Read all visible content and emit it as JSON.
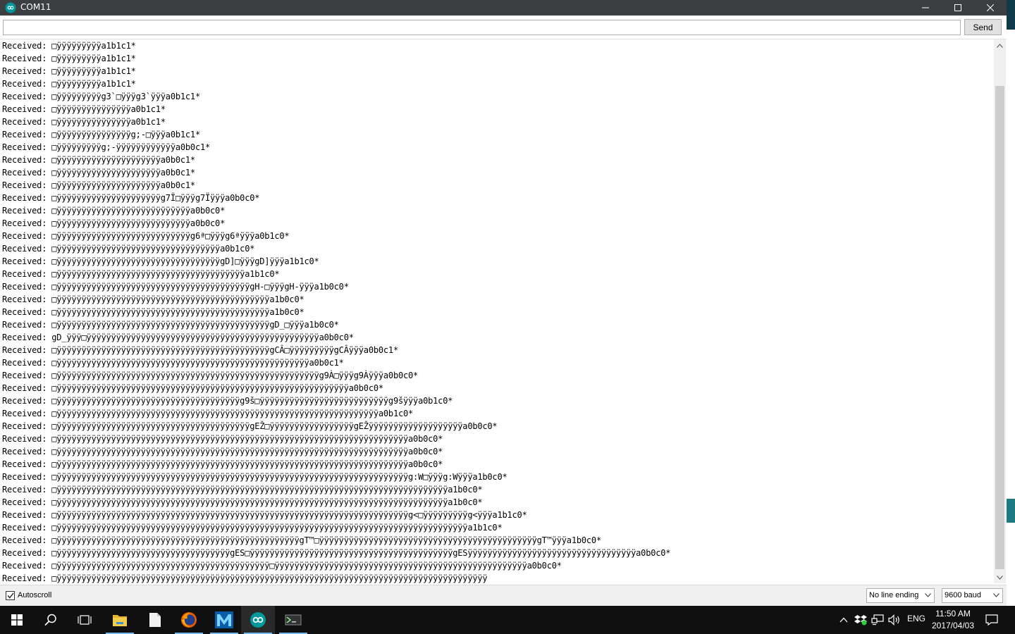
{
  "window": {
    "title": "COM11",
    "accent_color": "#00979c",
    "titlebar_color": "#3c3f41"
  },
  "toolbar": {
    "input_value": "",
    "send_label": "Send"
  },
  "output_lines": [
    "Received: □ÿÿÿÿÿÿÿÿÿa1b1c1*",
    "Received: □ÿÿÿÿÿÿÿÿÿa1b1c1*",
    "Received: □ÿÿÿÿÿÿÿÿÿa1b1c1*",
    "Received: □ÿÿÿÿÿÿÿÿÿa1b1c1*",
    "Received: □ÿÿÿÿÿÿÿÿÿg3`□ÿÿÿg3`ÿÿÿa0b1c1*",
    "Received: □ÿÿÿÿÿÿÿÿÿÿÿÿÿÿÿa0b1c1*",
    "Received: □ÿÿÿÿÿÿÿÿÿÿÿÿÿÿÿa0b1c1*",
    "Received: □ÿÿÿÿÿÿÿÿÿÿÿÿÿÿÿg;-□ÿÿÿa0b1c1*",
    "Received: □ÿÿÿÿÿÿÿÿÿg;-ÿÿÿÿÿÿÿÿÿÿÿÿa0b0c1*",
    "Received: □ÿÿÿÿÿÿÿÿÿÿÿÿÿÿÿÿÿÿÿÿÿa0b0c1*",
    "Received: □ÿÿÿÿÿÿÿÿÿÿÿÿÿÿÿÿÿÿÿÿÿa0b0c1*",
    "Received: □ÿÿÿÿÿÿÿÿÿÿÿÿÿÿÿÿÿÿÿÿÿa0b0c1*",
    "Received: □ÿÿÿÿÿÿÿÿÿÿÿÿÿÿÿÿÿÿÿÿÿg7Ï□ÿÿÿg7Ïÿÿÿa0b0c0*",
    "Received: □ÿÿÿÿÿÿÿÿÿÿÿÿÿÿÿÿÿÿÿÿÿÿÿÿÿÿÿa0b0c0*",
    "Received: □ÿÿÿÿÿÿÿÿÿÿÿÿÿÿÿÿÿÿÿÿÿÿÿÿÿÿÿa0b0c0*",
    "Received: □ÿÿÿÿÿÿÿÿÿÿÿÿÿÿÿÿÿÿÿÿÿÿÿÿÿÿÿg6ª□ÿÿÿg6ªÿÿÿa0b1c0*",
    "Received: □ÿÿÿÿÿÿÿÿÿÿÿÿÿÿÿÿÿÿÿÿÿÿÿÿÿÿÿÿÿÿÿÿÿa0b1c0*",
    "Received: □ÿÿÿÿÿÿÿÿÿÿÿÿÿÿÿÿÿÿÿÿÿÿÿÿÿÿÿÿÿÿÿÿÿgD]□ÿÿÿgD]ÿÿÿa1b1c0*",
    "Received: □ÿÿÿÿÿÿÿÿÿÿÿÿÿÿÿÿÿÿÿÿÿÿÿÿÿÿÿÿÿÿÿÿÿÿÿÿÿÿa1b1c0*",
    "Received: □ÿÿÿÿÿÿÿÿÿÿÿÿÿÿÿÿÿÿÿÿÿÿÿÿÿÿÿÿÿÿÿÿÿÿÿÿÿÿÿgH-□ÿÿÿgH-ÿÿÿa1b0c0*",
    "Received: □ÿÿÿÿÿÿÿÿÿÿÿÿÿÿÿÿÿÿÿÿÿÿÿÿÿÿÿÿÿÿÿÿÿÿÿÿÿÿÿÿÿÿÿa1b0c0*",
    "Received: □ÿÿÿÿÿÿÿÿÿÿÿÿÿÿÿÿÿÿÿÿÿÿÿÿÿÿÿÿÿÿÿÿÿÿÿÿÿÿÿÿÿÿÿa1b0c0*",
    "Received: □ÿÿÿÿÿÿÿÿÿÿÿÿÿÿÿÿÿÿÿÿÿÿÿÿÿÿÿÿÿÿÿÿÿÿÿÿÿÿÿÿÿÿÿgD_□ÿÿÿa1b0c0*",
    "Received: gD_ÿÿÿ□ÿÿÿÿÿÿÿÿÿÿÿÿÿÿÿÿÿÿÿÿÿÿÿÿÿÿÿÿÿÿÿÿÿÿÿÿÿÿÿÿÿÿÿÿÿÿÿa0b0c0*",
    "Received: □ÿÿÿÿÿÿÿÿÿÿÿÿÿÿÿÿÿÿÿÿÿÿÿÿÿÿÿÿÿÿÿÿÿÿÿÿÿÿÿÿÿÿÿgCÂ□ÿÿÿÿÿÿÿÿÿgCÂÿÿÿa0b0c1*",
    "Received: □ÿÿÿÿÿÿÿÿÿÿÿÿÿÿÿÿÿÿÿÿÿÿÿÿÿÿÿÿÿÿÿÿÿÿÿÿÿÿÿÿÿÿÿÿÿÿÿÿÿÿÿa0b0c1*",
    "Received: □ÿÿÿÿÿÿÿÿÿÿÿÿÿÿÿÿÿÿÿÿÿÿÿÿÿÿÿÿÿÿÿÿÿÿÿÿÿÿÿÿÿÿÿÿÿÿÿÿÿÿÿÿÿg9À□ÿÿÿg9Àÿÿÿa0b0c0*",
    "Received: □ÿÿÿÿÿÿÿÿÿÿÿÿÿÿÿÿÿÿÿÿÿÿÿÿÿÿÿÿÿÿÿÿÿÿÿÿÿÿÿÿÿÿÿÿÿÿÿÿÿÿÿÿÿÿÿÿÿÿÿa0b0c0*",
    "Received: □ÿÿÿÿÿÿÿÿÿÿÿÿÿÿÿÿÿÿÿÿÿÿÿÿÿÿÿÿÿÿÿÿÿÿÿÿÿg9š□ÿÿÿÿÿÿÿÿÿÿÿÿÿÿÿÿÿÿÿÿÿÿÿÿÿÿg9šÿÿÿa0b1c0*",
    "Received: □ÿÿÿÿÿÿÿÿÿÿÿÿÿÿÿÿÿÿÿÿÿÿÿÿÿÿÿÿÿÿÿÿÿÿÿÿÿÿÿÿÿÿÿÿÿÿÿÿÿÿÿÿÿÿÿÿÿÿÿÿÿÿÿÿÿa0b1c0*",
    "Received: □ÿÿÿÿÿÿÿÿÿÿÿÿÿÿÿÿÿÿÿÿÿÿÿÿÿÿÿÿÿÿÿÿÿÿÿÿÿÿÿgEŽ□ÿÿÿÿÿÿÿÿÿÿÿÿÿÿÿÿÿgEŽÿÿÿÿÿÿÿÿÿÿÿÿÿÿÿÿÿÿÿa0b0c0*",
    "Received: □ÿÿÿÿÿÿÿÿÿÿÿÿÿÿÿÿÿÿÿÿÿÿÿÿÿÿÿÿÿÿÿÿÿÿÿÿÿÿÿÿÿÿÿÿÿÿÿÿÿÿÿÿÿÿÿÿÿÿÿÿÿÿÿÿÿÿÿÿÿÿÿa0b0c0*",
    "Received: □ÿÿÿÿÿÿÿÿÿÿÿÿÿÿÿÿÿÿÿÿÿÿÿÿÿÿÿÿÿÿÿÿÿÿÿÿÿÿÿÿÿÿÿÿÿÿÿÿÿÿÿÿÿÿÿÿÿÿÿÿÿÿÿÿÿÿÿÿÿÿÿa0b0c0*",
    "Received: □ÿÿÿÿÿÿÿÿÿÿÿÿÿÿÿÿÿÿÿÿÿÿÿÿÿÿÿÿÿÿÿÿÿÿÿÿÿÿÿÿÿÿÿÿÿÿÿÿÿÿÿÿÿÿÿÿÿÿÿÿÿÿÿÿÿÿÿÿÿÿÿa0b0c0*",
    "Received: □ÿÿÿÿÿÿÿÿÿÿÿÿÿÿÿÿÿÿÿÿÿÿÿÿÿÿÿÿÿÿÿÿÿÿÿÿÿÿÿÿÿÿÿÿÿÿÿÿÿÿÿÿÿÿÿÿÿÿÿÿÿÿÿÿÿÿÿÿÿÿÿg:W□ÿÿÿg:Wÿÿÿa1b0c0*",
    "Received: □ÿÿÿÿÿÿÿÿÿÿÿÿÿÿÿÿÿÿÿÿÿÿÿÿÿÿÿÿÿÿÿÿÿÿÿÿÿÿÿÿÿÿÿÿÿÿÿÿÿÿÿÿÿÿÿÿÿÿÿÿÿÿÿÿÿÿÿÿÿÿÿÿÿÿÿÿÿÿÿa1b0c0*",
    "Received: □ÿÿÿÿÿÿÿÿÿÿÿÿÿÿÿÿÿÿÿÿÿÿÿÿÿÿÿÿÿÿÿÿÿÿÿÿÿÿÿÿÿÿÿÿÿÿÿÿÿÿÿÿÿÿÿÿÿÿÿÿÿÿÿÿÿÿÿÿÿÿÿÿÿÿÿÿÿÿÿa1b0c0*",
    "Received: □ÿÿÿÿÿÿÿÿÿÿÿÿÿÿÿÿÿÿÿÿÿÿÿÿÿÿÿÿÿÿÿÿÿÿÿÿÿÿÿÿÿÿÿÿÿÿÿÿÿÿÿÿÿÿÿÿÿÿÿÿÿÿÿÿÿÿÿÿÿÿÿg<□ÿÿÿÿÿÿÿÿÿg<ÿÿÿa1b1c0*",
    "Received: □ÿÿÿÿÿÿÿÿÿÿÿÿÿÿÿÿÿÿÿÿÿÿÿÿÿÿÿÿÿÿÿÿÿÿÿÿÿÿÿÿÿÿÿÿÿÿÿÿÿÿÿÿÿÿÿÿÿÿÿÿÿÿÿÿÿÿÿÿÿÿÿÿÿÿÿÿÿÿÿÿÿÿÿa1b1c0*",
    "Received: □ÿÿÿÿÿÿÿÿÿÿÿÿÿÿÿÿÿÿÿÿÿÿÿÿÿÿÿÿÿÿÿÿÿÿÿÿÿÿÿÿÿÿÿÿÿÿÿÿÿgT™□ÿÿÿÿÿÿÿÿÿÿÿÿÿÿÿÿÿÿÿÿÿÿÿÿÿÿÿÿÿÿÿÿÿÿÿÿÿÿÿÿÿÿÿÿgT™ÿÿÿa1b0c0*",
    "Received: □ÿÿÿÿÿÿÿÿÿÿÿÿÿÿÿÿÿÿÿÿÿÿÿÿÿÿÿÿÿÿÿÿÿÿÿgES□ÿÿÿÿÿÿÿÿÿÿÿÿÿÿÿÿÿÿÿÿÿÿÿÿÿÿÿÿÿÿÿÿÿÿÿÿÿÿÿÿÿgESÿÿÿÿÿÿÿÿÿÿÿÿÿÿÿÿÿÿÿÿÿÿÿÿÿÿÿÿÿÿÿÿÿÿa0b0c0*",
    "Received: □ÿÿÿÿÿÿÿÿÿÿÿÿÿÿÿÿÿÿÿÿÿÿÿÿÿÿÿÿÿÿÿÿÿÿÿÿÿÿÿÿÿÿÿ□ÿÿÿÿÿÿÿÿÿÿÿÿÿÿÿÿÿÿÿÿÿÿÿÿÿÿÿÿÿÿÿÿÿÿÿÿÿÿÿÿÿÿÿÿÿÿÿÿÿÿÿa0b0c0*",
    "Received: □ÿÿÿÿÿÿÿÿÿÿÿÿÿÿÿÿÿÿÿÿÿÿÿÿÿÿÿÿÿÿÿÿÿÿÿÿÿÿÿÿÿÿÿÿÿÿÿÿÿÿÿÿÿÿÿÿÿÿÿÿÿÿÿÿÿÿÿÿÿÿÿÿÿÿÿÿÿÿÿÿÿÿÿÿÿÿÿ"
  ],
  "statusbar": {
    "autoscroll_label": "Autoscroll",
    "autoscroll_checked": true,
    "line_ending": "No line ending",
    "baud_rate": "9600 baud"
  },
  "taskbar": {
    "items": [
      "start-icon",
      "search-icon",
      "task-view-icon",
      "file-explorer-icon",
      "document-icon",
      "firefox-icon",
      "maple-icon",
      "arduino-icon",
      "terminal-icon"
    ],
    "active_item": "arduino-icon",
    "language": "ENG",
    "time": "11:50 AM",
    "date": "2017/04/03"
  }
}
